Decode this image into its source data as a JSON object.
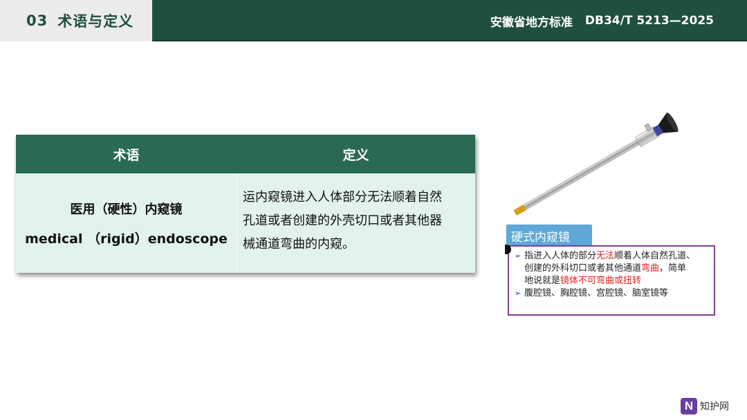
{
  "header": {
    "section_number": "03",
    "section_title": "术语与定义",
    "standard_issuer": "安徽省地方标准",
    "standard_code": "DB34/T 5213—2025"
  },
  "table": {
    "col_term": "术语",
    "col_definition": "定义",
    "term_zh": "医用（硬性）内窥镜",
    "term_en": "medical （rigid）endoscope",
    "definition_lines": [
      "运内窥镜进入人体部分无法顺着自然",
      "孔道或者创建的外壳切口或者其他器",
      "械通道弯曲的内窥。"
    ]
  },
  "illustration": {
    "caption_title": "硬式内窥镜",
    "line1_a": "指进入人体的部分",
    "line1_red": "无法",
    "line1_b": "顺着人体自然孔道、",
    "line2_a": "创建的外科切口或者其他通道",
    "line2_red": "弯曲",
    "line2_b": "，简单",
    "line3_a": "地说就是",
    "line3_red": "镜体不可弯曲或扭转",
    "line4": "腹腔镜、胸腔镜、宫腔镜、脑室镜等",
    "arrow": "➢"
  },
  "watermark": {
    "logo_letter": "N",
    "text": "知护网"
  },
  "colors": {
    "header_green": "#1f4f3f",
    "table_header_green": "#2a6a52",
    "table_body": "#e2f2ee",
    "caption_title_blue": "#5ea8d8",
    "caption_border_purple": "#7b3f93",
    "emphasis_red": "#e02020"
  }
}
